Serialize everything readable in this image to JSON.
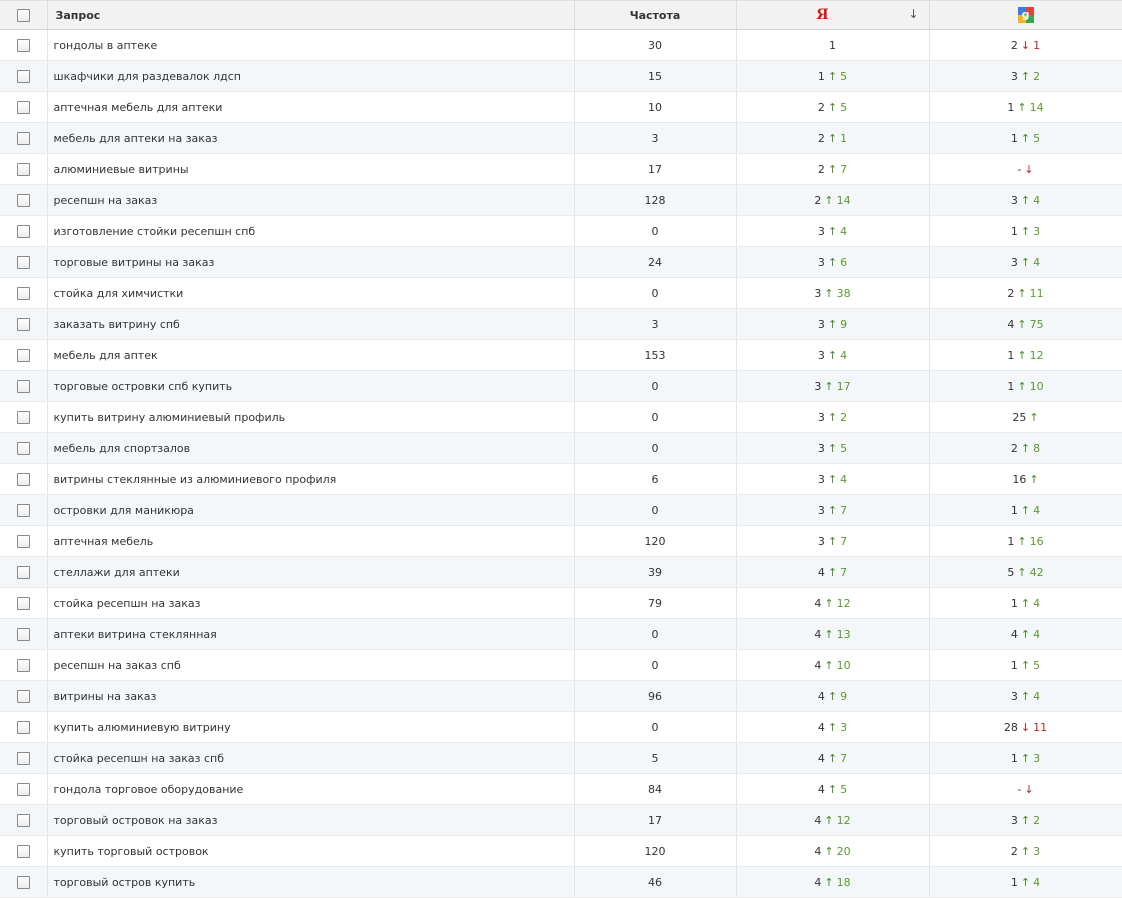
{
  "header": {
    "query_label": "Запрос",
    "freq_label": "Частота",
    "yandex_label": "Я",
    "yandex_sort_icon": "↓",
    "google_icon": "google-icon"
  },
  "rows": [
    {
      "query": "гондолы в аптеке",
      "freq": "30",
      "ya": {
        "pos": "1",
        "dir": "",
        "delta": ""
      },
      "g": {
        "pos": "2",
        "dir": "down",
        "delta": "1"
      }
    },
    {
      "query": "шкафчики для раздевалок лдсп",
      "freq": "15",
      "ya": {
        "pos": "1",
        "dir": "up",
        "delta": "5"
      },
      "g": {
        "pos": "3",
        "dir": "up",
        "delta": "2"
      }
    },
    {
      "query": "аптечная мебель для аптеки",
      "freq": "10",
      "ya": {
        "pos": "2",
        "dir": "up",
        "delta": "5"
      },
      "g": {
        "pos": "1",
        "dir": "up",
        "delta": "14"
      }
    },
    {
      "query": "мебель для аптеки на заказ",
      "freq": "3",
      "ya": {
        "pos": "2",
        "dir": "up",
        "delta": "1"
      },
      "g": {
        "pos": "1",
        "dir": "up",
        "delta": "5"
      }
    },
    {
      "query": "алюминиевые витрины",
      "freq": "17",
      "ya": {
        "pos": "2",
        "dir": "up",
        "delta": "7"
      },
      "g": {
        "pos": "-",
        "dir": "down",
        "delta": ""
      }
    },
    {
      "query": "ресепшн на заказ",
      "freq": "128",
      "ya": {
        "pos": "2",
        "dir": "up",
        "delta": "14"
      },
      "g": {
        "pos": "3",
        "dir": "up",
        "delta": "4"
      }
    },
    {
      "query": "изготовление стойки ресепшн спб",
      "freq": "0",
      "ya": {
        "pos": "3",
        "dir": "up",
        "delta": "4"
      },
      "g": {
        "pos": "1",
        "dir": "up",
        "delta": "3"
      }
    },
    {
      "query": "торговые витрины на заказ",
      "freq": "24",
      "ya": {
        "pos": "3",
        "dir": "up",
        "delta": "6"
      },
      "g": {
        "pos": "3",
        "dir": "up",
        "delta": "4"
      }
    },
    {
      "query": "стойка для химчистки",
      "freq": "0",
      "ya": {
        "pos": "3",
        "dir": "up",
        "delta": "38"
      },
      "g": {
        "pos": "2",
        "dir": "up",
        "delta": "11"
      }
    },
    {
      "query": "заказать витрину спб",
      "freq": "3",
      "ya": {
        "pos": "3",
        "dir": "up",
        "delta": "9"
      },
      "g": {
        "pos": "4",
        "dir": "up",
        "delta": "75"
      }
    },
    {
      "query": "мебель для аптек",
      "freq": "153",
      "ya": {
        "pos": "3",
        "dir": "up",
        "delta": "4"
      },
      "g": {
        "pos": "1",
        "dir": "up",
        "delta": "12"
      }
    },
    {
      "query": "торговые островки спб купить",
      "freq": "0",
      "ya": {
        "pos": "3",
        "dir": "up",
        "delta": "17"
      },
      "g": {
        "pos": "1",
        "dir": "up",
        "delta": "10"
      }
    },
    {
      "query": "купить витрину алюминиевый профиль",
      "freq": "0",
      "ya": {
        "pos": "3",
        "dir": "up",
        "delta": "2"
      },
      "g": {
        "pos": "25",
        "dir": "up",
        "delta": ""
      }
    },
    {
      "query": "мебель для спортзалов",
      "freq": "0",
      "ya": {
        "pos": "3",
        "dir": "up",
        "delta": "5"
      },
      "g": {
        "pos": "2",
        "dir": "up",
        "delta": "8"
      }
    },
    {
      "query": "витрины стеклянные из алюминиевого профиля",
      "freq": "6",
      "ya": {
        "pos": "3",
        "dir": "up",
        "delta": "4"
      },
      "g": {
        "pos": "16",
        "dir": "up",
        "delta": ""
      }
    },
    {
      "query": "островки для маникюра",
      "freq": "0",
      "ya": {
        "pos": "3",
        "dir": "up",
        "delta": "7"
      },
      "g": {
        "pos": "1",
        "dir": "up",
        "delta": "4"
      }
    },
    {
      "query": "аптечная мебель",
      "freq": "120",
      "ya": {
        "pos": "3",
        "dir": "up",
        "delta": "7"
      },
      "g": {
        "pos": "1",
        "dir": "up",
        "delta": "16"
      }
    },
    {
      "query": "стеллажи для аптеки",
      "freq": "39",
      "ya": {
        "pos": "4",
        "dir": "up",
        "delta": "7"
      },
      "g": {
        "pos": "5",
        "dir": "up",
        "delta": "42"
      }
    },
    {
      "query": "стойка ресепшн на заказ",
      "freq": "79",
      "ya": {
        "pos": "4",
        "dir": "up",
        "delta": "12"
      },
      "g": {
        "pos": "1",
        "dir": "up",
        "delta": "4"
      }
    },
    {
      "query": "аптеки витрина стеклянная",
      "freq": "0",
      "ya": {
        "pos": "4",
        "dir": "up",
        "delta": "13"
      },
      "g": {
        "pos": "4",
        "dir": "up",
        "delta": "4"
      }
    },
    {
      "query": "ресепшн на заказ спб",
      "freq": "0",
      "ya": {
        "pos": "4",
        "dir": "up",
        "delta": "10"
      },
      "g": {
        "pos": "1",
        "dir": "up",
        "delta": "5"
      }
    },
    {
      "query": "витрины на заказ",
      "freq": "96",
      "ya": {
        "pos": "4",
        "dir": "up",
        "delta": "9"
      },
      "g": {
        "pos": "3",
        "dir": "up",
        "delta": "4"
      }
    },
    {
      "query": "купить алюминиевую витрину",
      "freq": "0",
      "ya": {
        "pos": "4",
        "dir": "up",
        "delta": "3"
      },
      "g": {
        "pos": "28",
        "dir": "down",
        "delta": "11"
      }
    },
    {
      "query": "стойка ресепшн на заказ спб",
      "freq": "5",
      "ya": {
        "pos": "4",
        "dir": "up",
        "delta": "7"
      },
      "g": {
        "pos": "1",
        "dir": "up",
        "delta": "3"
      }
    },
    {
      "query": "гондола торговое оборудование",
      "freq": "84",
      "ya": {
        "pos": "4",
        "dir": "up",
        "delta": "5"
      },
      "g": {
        "pos": "-",
        "dir": "down",
        "delta": ""
      }
    },
    {
      "query": "торговый островок на заказ",
      "freq": "17",
      "ya": {
        "pos": "4",
        "dir": "up",
        "delta": "12"
      },
      "g": {
        "pos": "3",
        "dir": "up",
        "delta": "2"
      }
    },
    {
      "query": "купить торговый островок",
      "freq": "120",
      "ya": {
        "pos": "4",
        "dir": "up",
        "delta": "20"
      },
      "g": {
        "pos": "2",
        "dir": "up",
        "delta": "3"
      }
    },
    {
      "query": "торговый остров купить",
      "freq": "46",
      "ya": {
        "pos": "4",
        "dir": "up",
        "delta": "18"
      },
      "g": {
        "pos": "1",
        "dir": "up",
        "delta": "4"
      }
    }
  ],
  "colors": {
    "up": "#4a8a28",
    "down": "#c12222",
    "yandex": "#d11d1d"
  }
}
